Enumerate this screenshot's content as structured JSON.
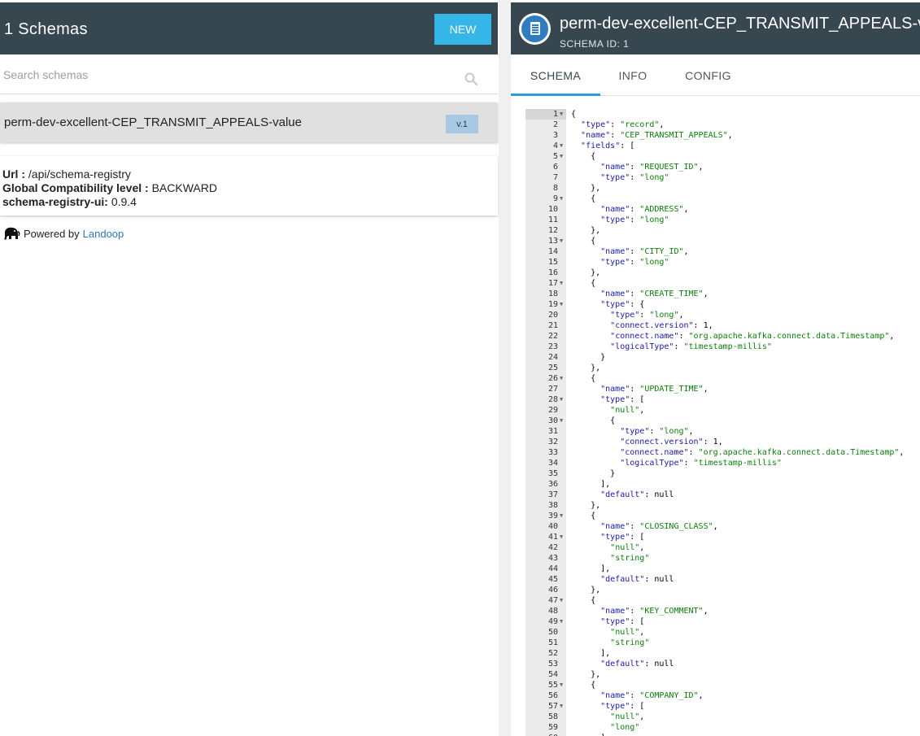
{
  "left": {
    "title": "1 Schemas",
    "new_button": "NEW",
    "search_placeholder": "Search schemas",
    "schema_item": {
      "name": "perm-dev-excellent-CEP_TRANSMIT_APPEALS-value",
      "version": "v.1"
    },
    "info": {
      "url_label": "Url :",
      "url_value": "/api/schema-registry",
      "compat_label": "Global Compatibility level :",
      "compat_value": "BACKWARD",
      "ui_label": "schema-registry-ui:",
      "ui_value": "0.9.4"
    },
    "powered_by": "Powered by",
    "powered_link": "Landoop"
  },
  "right": {
    "title": "perm-dev-excellent-CEP_TRANSMIT_APPEALS-value",
    "subtitle": "SCHEMA ID: 1",
    "tabs": [
      "SCHEMA",
      "INFO",
      "CONFIG"
    ]
  },
  "code_lines": [
    "{",
    "  \"type\": \"record\",",
    "  \"name\": \"CEP_TRANSMIT_APPEALS\",",
    "  \"fields\": [",
    "    {",
    "      \"name\": \"REQUEST_ID\",",
    "      \"type\": \"long\"",
    "    },",
    "    {",
    "      \"name\": \"ADDRESS\",",
    "      \"type\": \"long\"",
    "    },",
    "    {",
    "      \"name\": \"CITY_ID\",",
    "      \"type\": \"long\"",
    "    },",
    "    {",
    "      \"name\": \"CREATE_TIME\",",
    "      \"type\": {",
    "        \"type\": \"long\",",
    "        \"connect.version\": 1,",
    "        \"connect.name\": \"org.apache.kafka.connect.data.Timestamp\",",
    "        \"logicalType\": \"timestamp-millis\"",
    "      }",
    "    },",
    "    {",
    "      \"name\": \"UPDATE_TIME\",",
    "      \"type\": [",
    "        \"null\",",
    "        {",
    "          \"type\": \"long\",",
    "          \"connect.version\": 1,",
    "          \"connect.name\": \"org.apache.kafka.connect.data.Timestamp\",",
    "          \"logicalType\": \"timestamp-millis\"",
    "        }",
    "      ],",
    "      \"default\": null",
    "    },",
    "    {",
    "      \"name\": \"CLOSING_CLASS\",",
    "      \"type\": [",
    "        \"null\",",
    "        \"string\"",
    "      ],",
    "      \"default\": null",
    "    },",
    "    {",
    "      \"name\": \"KEY_COMMENT\",",
    "      \"type\": [",
    "        \"null\",",
    "        \"string\"",
    "      ],",
    "      \"default\": null",
    "    },",
    "    {",
    "      \"name\": \"COMPANY_ID\",",
    "      \"type\": [",
    "        \"null\",",
    "        \"long\"",
    "      ],"
  ],
  "fold_lines": [
    1,
    4,
    5,
    9,
    13,
    17,
    19,
    26,
    28,
    30,
    39,
    41,
    47,
    49,
    55,
    57
  ]
}
